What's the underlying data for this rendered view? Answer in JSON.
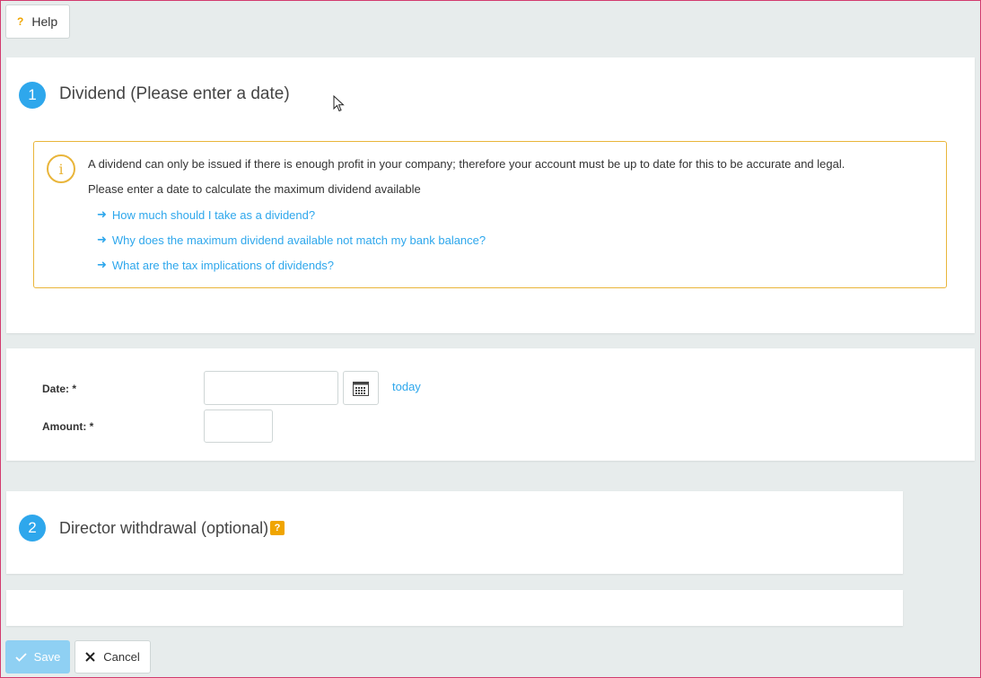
{
  "help": {
    "icon": "question-icon",
    "icon_glyph": "?",
    "label": "Help"
  },
  "dividend": {
    "step_number": "1",
    "title": "Dividend (Please enter a date)",
    "info_icon_glyph": "i",
    "info_text": "A dividend can only be issued if there is enough profit in your company; therefore your account must be up to date for this to be accurate and legal.",
    "info_subtext": "Please enter a date to calculate the maximum dividend available",
    "links": [
      "How much should I take as a dividend?",
      "Why does the maximum dividend available not match my bank balance?",
      "What are the tax implications of dividends?"
    ]
  },
  "form": {
    "date_label": "Date: *",
    "date_value": "",
    "calendar_icon": "calendar-icon",
    "today_label": "today",
    "amount_label": "Amount: *",
    "amount_value": ""
  },
  "director": {
    "step_number": "2",
    "title": "Director withdrawal (optional)",
    "help_badge": "?"
  },
  "actions": {
    "save_label": "Save",
    "cancel_label": "Cancel"
  },
  "colors": {
    "accent": "#2ea7ec",
    "warning": "#e9b53a",
    "help_badge": "#f0a500",
    "save_disabled": "#8fd0f3",
    "frame_border": "#d23a6e"
  }
}
